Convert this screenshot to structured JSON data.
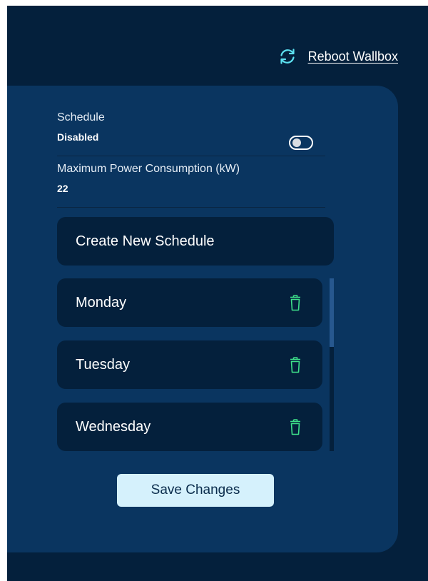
{
  "header": {
    "reboot_label": "Reboot Wallbox",
    "reboot_icon": "refresh-icon",
    "accent_color": "#5ce0f0"
  },
  "settings": {
    "schedule": {
      "title": "Schedule",
      "value": "Disabled",
      "toggle_on": false
    },
    "max_power": {
      "title": "Maximum Power Consumption (kW)",
      "value": "22"
    }
  },
  "create_schedule_label": "Create New Schedule",
  "schedules": [
    {
      "day": "Monday",
      "icon": "trash-icon"
    },
    {
      "day": "Tuesday",
      "icon": "trash-icon"
    },
    {
      "day": "Wednesday",
      "icon": "trash-icon"
    }
  ],
  "trash_icon_color": "#3ee08a",
  "save_label": "Save Changes",
  "colors": {
    "background": "#04203c",
    "panel": "#0a3560",
    "card": "#04203c",
    "save_button": "#d5f1fc"
  }
}
